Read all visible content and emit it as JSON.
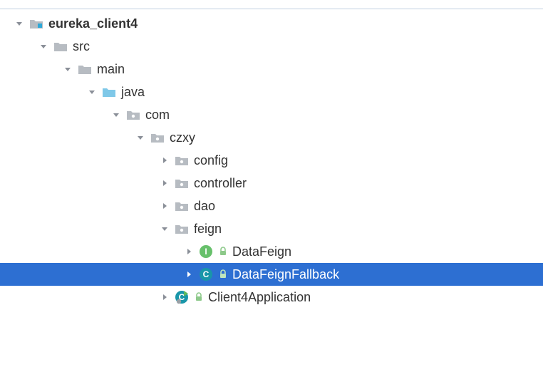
{
  "tree": {
    "indent_unit": 34,
    "base_pad": 18,
    "nodes": [
      {
        "depth": 0,
        "expanded": true,
        "icon": "module-folder",
        "label": "eureka_client4",
        "bold": true,
        "selected": false
      },
      {
        "depth": 1,
        "expanded": true,
        "icon": "folder-gray",
        "label": "src",
        "bold": false,
        "selected": false
      },
      {
        "depth": 2,
        "expanded": true,
        "icon": "folder-gray",
        "label": "main",
        "bold": false,
        "selected": false
      },
      {
        "depth": 3,
        "expanded": true,
        "icon": "folder-blue",
        "label": "java",
        "bold": false,
        "selected": false
      },
      {
        "depth": 4,
        "expanded": true,
        "icon": "package",
        "label": "com",
        "bold": false,
        "selected": false
      },
      {
        "depth": 5,
        "expanded": true,
        "icon": "package",
        "label": "czxy",
        "bold": false,
        "selected": false
      },
      {
        "depth": 6,
        "expanded": false,
        "icon": "package",
        "label": "config",
        "bold": false,
        "selected": false
      },
      {
        "depth": 6,
        "expanded": false,
        "icon": "package",
        "label": "controller",
        "bold": false,
        "selected": false
      },
      {
        "depth": 6,
        "expanded": false,
        "icon": "package",
        "label": "dao",
        "bold": false,
        "selected": false
      },
      {
        "depth": 6,
        "expanded": true,
        "icon": "package",
        "label": "feign",
        "bold": false,
        "selected": false
      },
      {
        "depth": 7,
        "expanded": false,
        "icon": "interface",
        "overlay": "lock",
        "label": "DataFeign",
        "bold": false,
        "selected": false
      },
      {
        "depth": 7,
        "expanded": false,
        "icon": "class",
        "overlay": "lock",
        "label": "DataFeignFallback",
        "bold": false,
        "selected": true
      },
      {
        "depth": 6,
        "expanded": false,
        "icon": "class-run",
        "overlay": "lock",
        "label": "Client4Application",
        "bold": false,
        "selected": false
      }
    ]
  },
  "colors": {
    "selection": "#2d6fd2",
    "arrow": "#8a8f98",
    "arrow_selected": "#ffffff",
    "folder_gray": "#b7bcc2",
    "folder_blue": "#7fc8e8",
    "package": "#b7bcc2",
    "interface_bg": "#67c06b",
    "class_bg": "#1996a9",
    "lock": "#8dc98a"
  }
}
